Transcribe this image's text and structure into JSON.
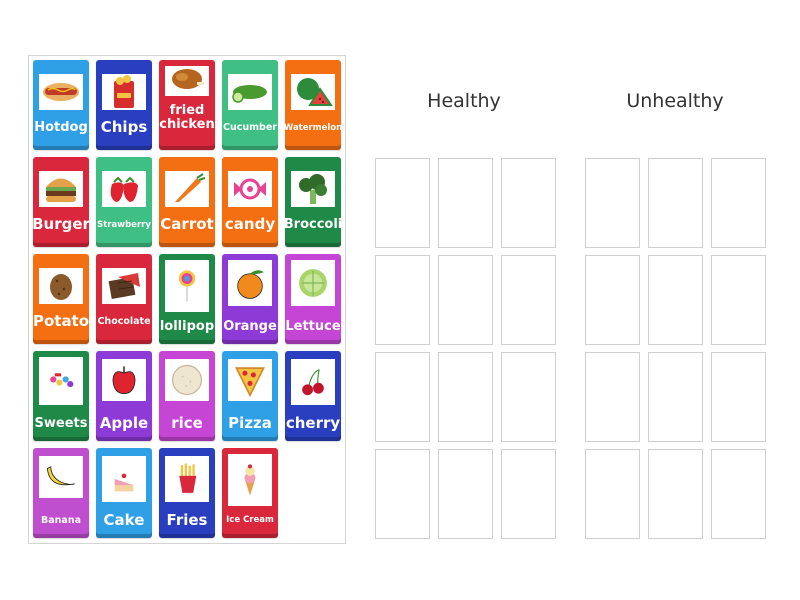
{
  "groups": {
    "healthy": "Healthy",
    "unhealthy": "Unhealthy"
  },
  "colors": {
    "blue": "#2f9fe6",
    "darkblue": "#2a3fbf",
    "red": "#d9283c",
    "green": "#3fbf83",
    "orange": "#f46e12",
    "darkgreen": "#1f8a48",
    "purple": "#8e3ad6",
    "pink": "#c545d5",
    "lightpink": "#c04fd0"
  },
  "cards": [
    {
      "label": "Hotdog",
      "icon": "hotdog-icon"
    },
    {
      "label": "Chips",
      "icon": "chips-icon"
    },
    {
      "label": "fried chicken",
      "icon": "fried-chicken-icon"
    },
    {
      "label": "Cucumber",
      "icon": "cucumber-icon"
    },
    {
      "label": "Watermelon",
      "icon": "watermelon-icon"
    },
    {
      "label": "Burger",
      "icon": "burger-icon"
    },
    {
      "label": "Strawberry",
      "icon": "strawberry-icon"
    },
    {
      "label": "Carrot",
      "icon": "carrot-icon"
    },
    {
      "label": "candy",
      "icon": "candy-icon"
    },
    {
      "label": "Broccoli",
      "icon": "broccoli-icon"
    },
    {
      "label": "Potato",
      "icon": "potato-icon"
    },
    {
      "label": "Chocolate",
      "icon": "chocolate-icon"
    },
    {
      "label": "lollipop",
      "icon": "lollipop-icon"
    },
    {
      "label": "Orange",
      "icon": "orange-icon"
    },
    {
      "label": "Lettuce",
      "icon": "lettuce-icon"
    },
    {
      "label": "Sweets",
      "icon": "sweets-icon"
    },
    {
      "label": "Apple",
      "icon": "apple-icon"
    },
    {
      "label": "rice",
      "icon": "rice-icon"
    },
    {
      "label": "Pizza",
      "icon": "pizza-icon"
    },
    {
      "label": "cherry",
      "icon": "cherry-icon"
    },
    {
      "label": "Banana",
      "icon": "banana-icon"
    },
    {
      "label": "Cake",
      "icon": "cake-icon"
    },
    {
      "label": "Fries",
      "icon": "fries-icon"
    },
    {
      "label": "Ice Cream",
      "icon": "ice-cream-icon"
    }
  ]
}
